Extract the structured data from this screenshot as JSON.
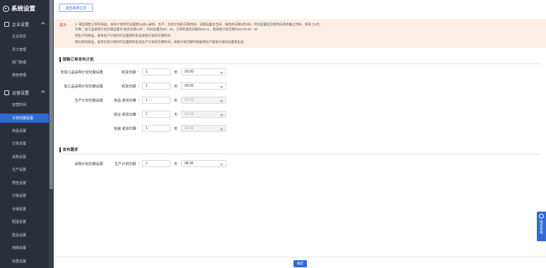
{
  "sidebar": {
    "title": "系统设置",
    "groups": [
      {
        "label": "企业设置",
        "items": [
          "企业信息",
          "员工管理",
          "部门管理",
          "角色管理"
        ]
      },
      {
        "label": "运营设置",
        "items": [
          "运营时间",
          "计划交期设置",
          "商品设置",
          "订单设置",
          "采购设置",
          "生产设置",
          "质检设置",
          "分拣设置",
          "仓储设置",
          "配送设置",
          "售后设置",
          "地磅设置",
          "标签设置"
        ]
      }
    ],
    "active_item": "计划交期设置"
  },
  "header": {
    "back_button": "返回系统主页"
  },
  "tips": {
    "label": "提示:",
    "lines": [
      "1. 来自销售订单的商品，发布计划时可设置默认进入采购、生产、包装计划的交期时间；日期设置含当日，填具体日期3月3日，时间设置指交期时间具体截止时间，如早上6点。",
      "示例：加工品采购计划交期设置为“收货日期-2天”，时间设置为06：00，订单的收货日期为08-11，则采购计划交期为08-09 06：00",
      "预生产的商品，发布生产计划时可设置原料生成采购计划的交期时间",
      "预包装的商品，发布包装计划时可设置原料生成生产计划的交期时间，采购计划交期时根据预生产发布计划的设置来生成"
    ]
  },
  "sections": {
    "sales_plan": {
      "title": "销售订单发布计划",
      "rows": [
        {
          "label": "非加工品采购计划交期设置:",
          "prefix": "收货日期",
          "dash": "-",
          "days": "1",
          "unit": "天",
          "time": "00:00",
          "disabled": false
        },
        {
          "label": "加工品采购计划交期设置:",
          "prefix": "收货日期",
          "dash": "-",
          "days": "1",
          "unit": "天",
          "time": "00:00",
          "disabled": false
        },
        {
          "label": "生产计划交期设置:",
          "prefix": "单品 收货日期",
          "dash": "-",
          "days": "1",
          "unit": "天",
          "time": "23:59",
          "disabled": true
        },
        {
          "label": "",
          "prefix": "组合 收货日期",
          "dash": "-",
          "days": "1",
          "unit": "天",
          "time": "23:59",
          "disabled": true
        },
        {
          "label": "",
          "prefix": "包装 收货日期",
          "dash": "-",
          "days": "1",
          "unit": "天",
          "time": "23:59",
          "disabled": true
        }
      ]
    },
    "release_demand": {
      "title": "发布需求",
      "rows": [
        {
          "label": "采购计划交期设置:",
          "prefix": "生产计划交期",
          "dash": "-",
          "days": "1",
          "unit": "天",
          "time": "08:30",
          "disabled": false
        }
      ]
    }
  },
  "footer": {
    "confirm_button": "确定"
  },
  "contact": {
    "label": "联系客服"
  }
}
